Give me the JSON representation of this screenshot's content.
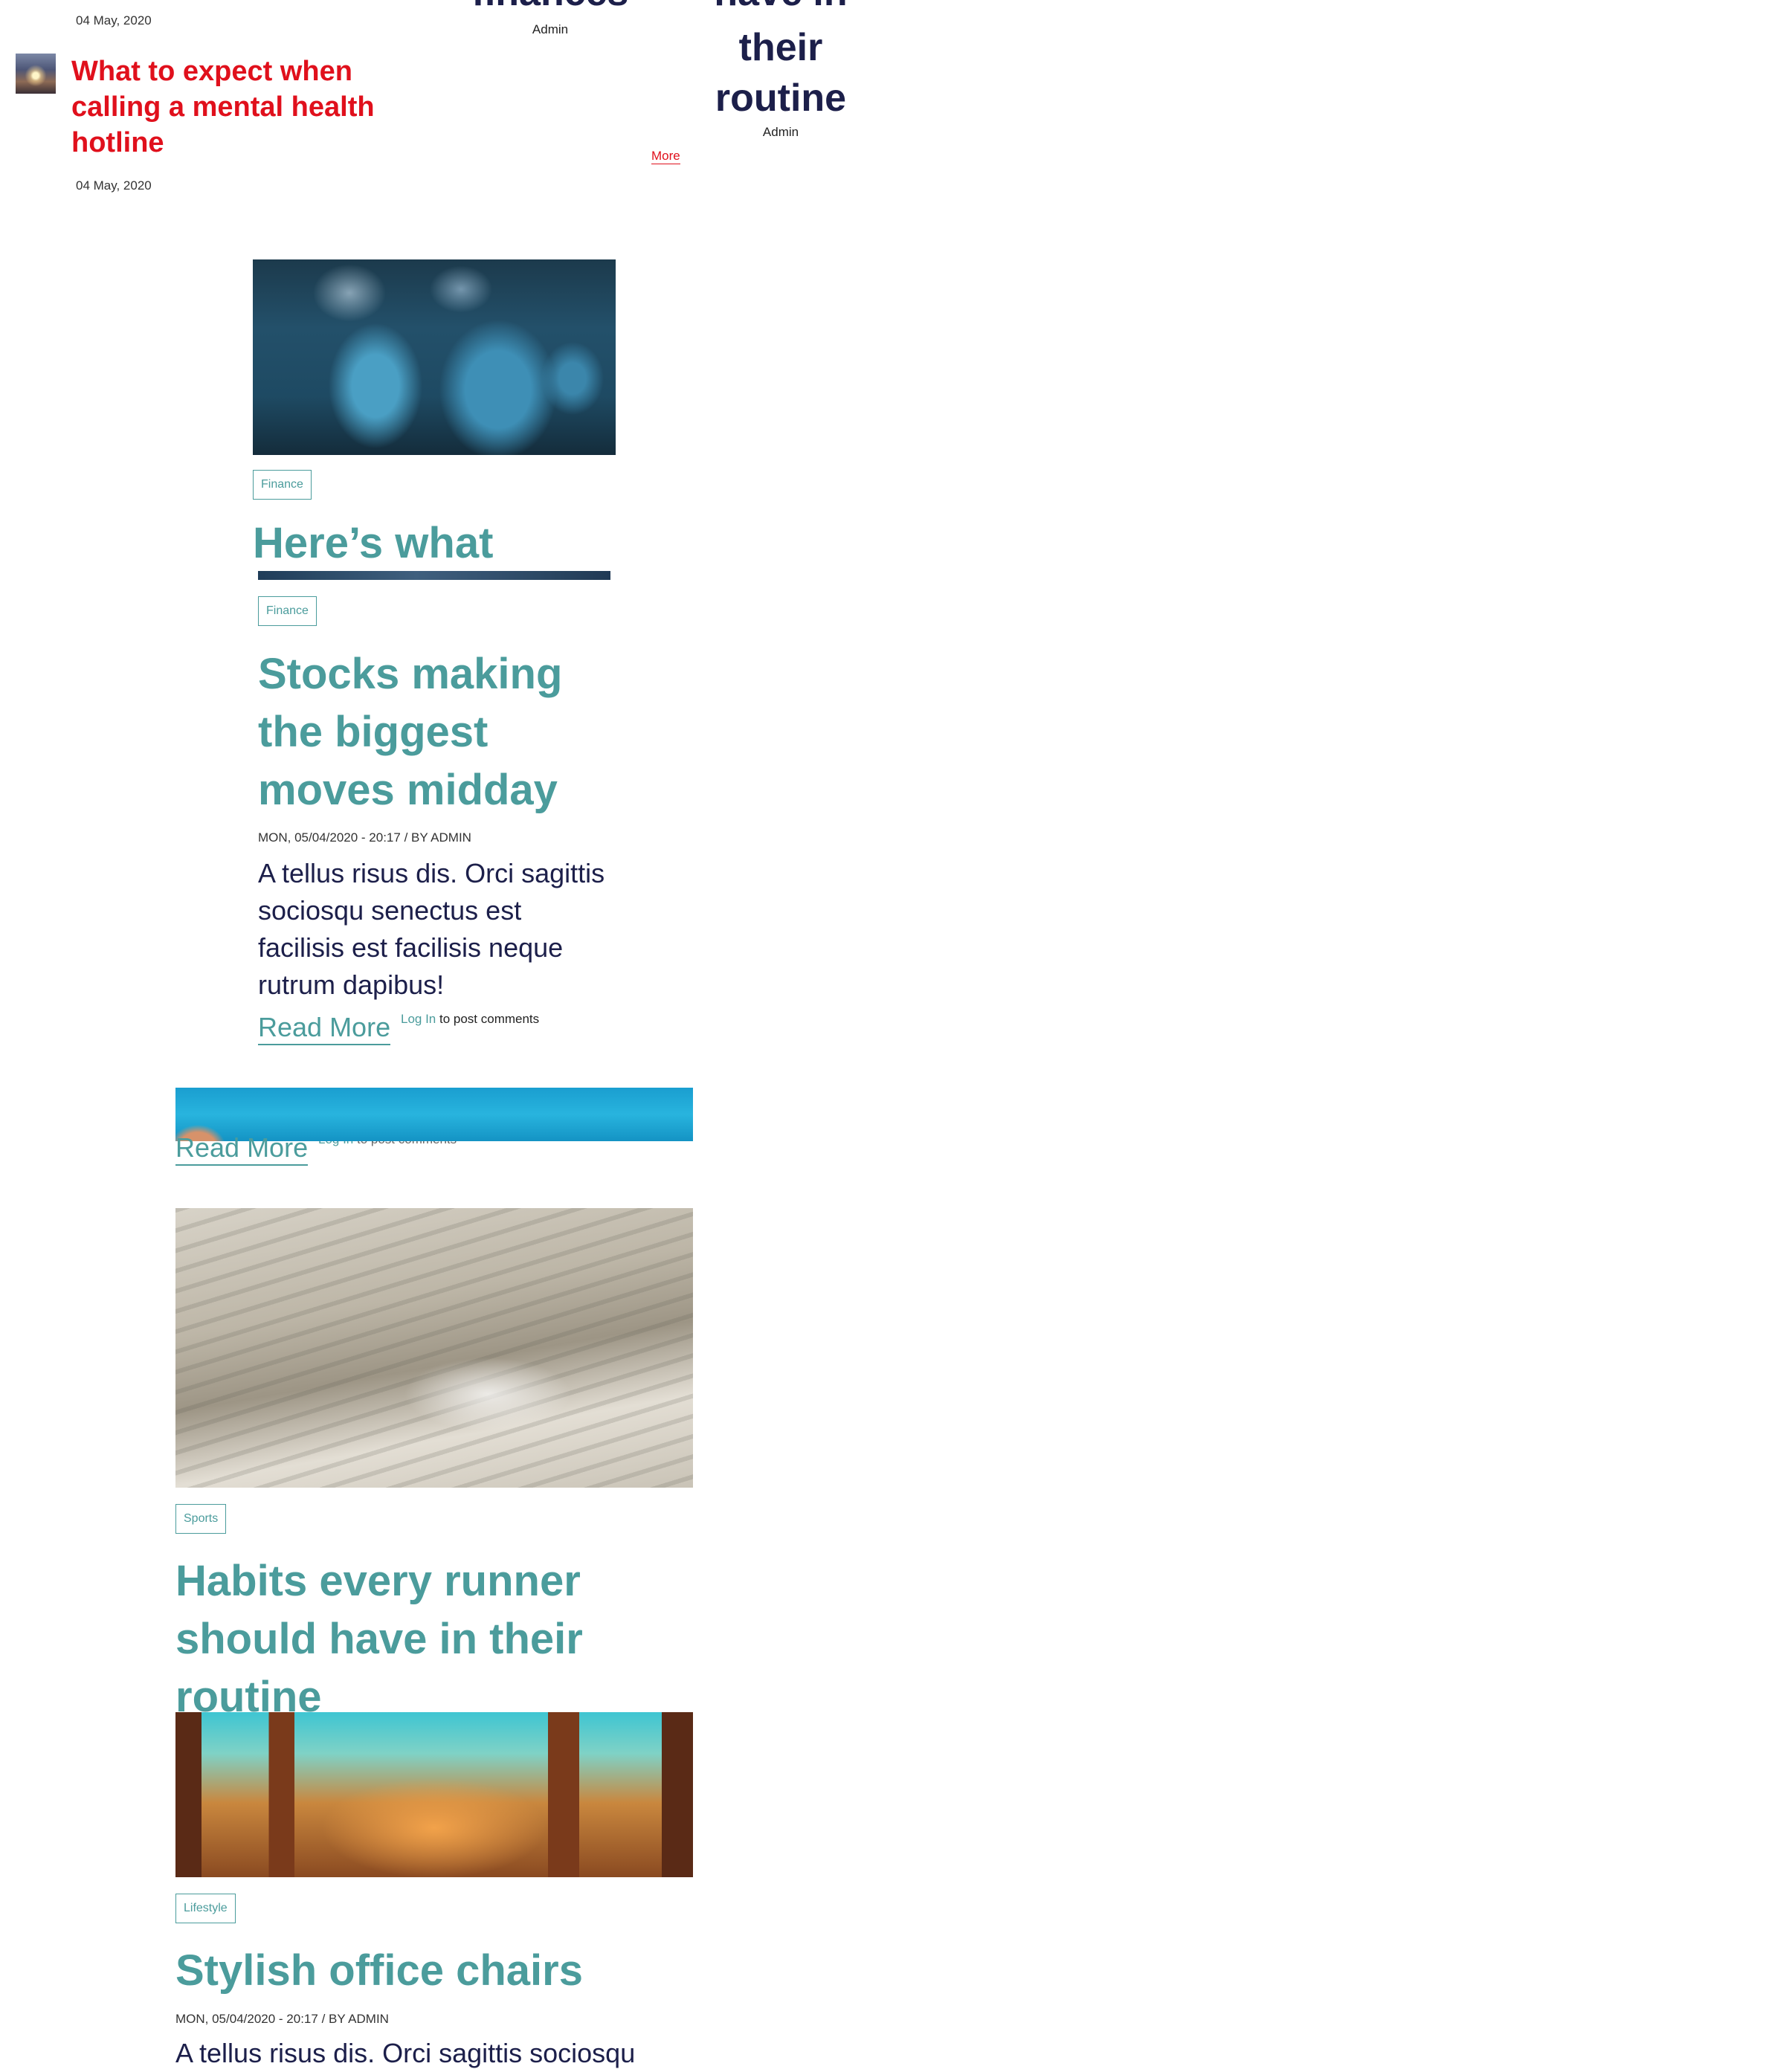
{
  "top": {
    "date_1": "04 May, 2020",
    "thumb_icon": "sunset-thumbnail-icon",
    "red_title": "What to expect when calling a mental health hotline",
    "date_2": "04 May, 2020",
    "mid_title_fragment": "finances",
    "mid_author": "Admin",
    "more_label": "More",
    "right_title_fragment": "have in",
    "right_title_line2": "their",
    "right_title_line3": "routine",
    "right_author": "Admin"
  },
  "articles": {
    "a1": {
      "tag": "Finance",
      "title_partial": "Here’s what"
    },
    "a2": {
      "tag": "Finance",
      "title": "Stocks making the biggest moves midday",
      "meta": "MON, 05/04/2020 - 20:17 / BY ADMIN",
      "body": "A tellus risus dis. Orci sagittis sociosqu senectus est facilisis est facilisis neque rutrum dapibus!",
      "read_more": "Read More",
      "login_link": "Log In",
      "login_suffix": " to post comments"
    },
    "a3": {
      "read_more": "Read More",
      "login_link": "Log In",
      "login_suffix": " to post comments"
    },
    "a4": {
      "tag": "Sports",
      "title": "Habits every runner should have in their routine"
    },
    "a5": {
      "tag": "Lifestyle",
      "title": "Stylish office chairs",
      "meta": "MON, 05/04/2020 - 20:17 / BY ADMIN",
      "body": "A tellus risus dis. Orci sagittis sociosqu"
    }
  },
  "colors": {
    "red": "#e0101c",
    "teal": "#4b9c9c",
    "navy": "#1c1f4a"
  }
}
